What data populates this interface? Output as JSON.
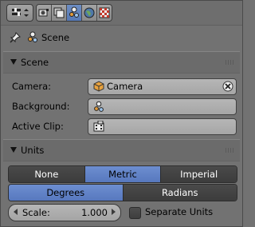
{
  "header": {
    "editor_type_icon": "properties-editor-icon",
    "context_icons": [
      "render-icon",
      "render-layers-icon",
      "scene-icon",
      "world-icon",
      "texture-icon"
    ],
    "active_context": "scene-icon"
  },
  "path": {
    "pin_icon": "pin-icon",
    "label": "Scene"
  },
  "scene_panel": {
    "title": "Scene",
    "camera": {
      "label": "Camera:",
      "value": "Camera",
      "icon": "camera-cube-icon"
    },
    "background": {
      "label": "Background:",
      "value": "",
      "icon": "scene-icon"
    },
    "active_clip": {
      "label": "Active Clip:",
      "value": "",
      "icon": "movie-clip-icon"
    }
  },
  "units_panel": {
    "title": "Units",
    "system_options": [
      "None",
      "Metric",
      "Imperial"
    ],
    "system_active": "Metric",
    "rotation_options": [
      "Degrees",
      "Radians"
    ],
    "rotation_active": "Degrees",
    "scale": {
      "label": "Scale:",
      "value": "1.000"
    },
    "separate_units": {
      "label": "Separate Units",
      "checked": false
    }
  },
  "colors": {
    "panel_bg": "#727272",
    "accent": "#5d7fc2",
    "field_bg": "#adadad",
    "dark_button": "#434343"
  }
}
